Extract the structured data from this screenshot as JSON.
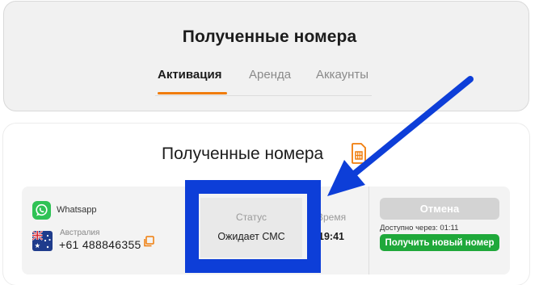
{
  "header": {
    "title": "Полученные номера",
    "tabs": [
      {
        "label": "Активация",
        "active": true
      },
      {
        "label": "Аренда",
        "active": false
      },
      {
        "label": "Аккаунты",
        "active": false
      }
    ]
  },
  "main": {
    "title": "Полученные номера",
    "row": {
      "service": "Whatsapp",
      "country": "Австралия",
      "phone": "+61 488846355",
      "status_label": "Статус",
      "status_value": "Ожидает СМС",
      "time_label": "Время",
      "time_value": "19:41",
      "cancel_label": "Отмена",
      "available_text": "Доступно через: 01:11",
      "new_number_label": "Получить новый номер"
    }
  },
  "colors": {
    "accent": "#f07c0a",
    "whatsapp": "#2fc255",
    "success": "#1fa83a",
    "annotation": "#0d3ed8"
  },
  "icons": [
    "sim-card-icon",
    "whatsapp-icon",
    "australia-flag-icon",
    "copy-icon"
  ]
}
